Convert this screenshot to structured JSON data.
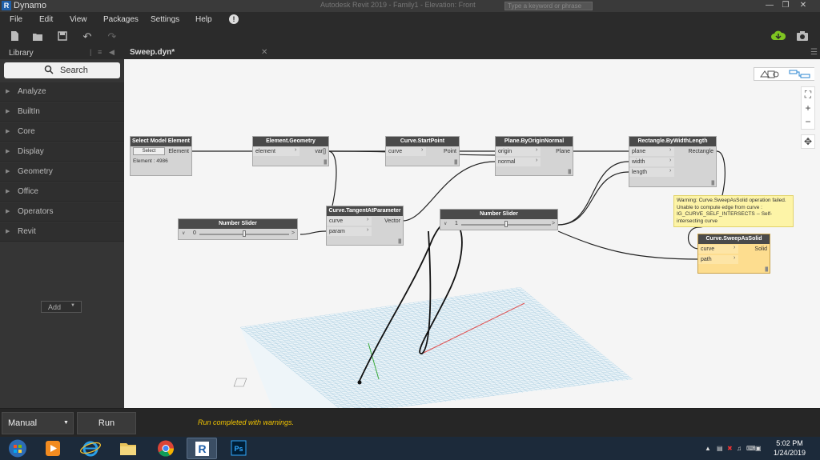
{
  "window": {
    "title": "Dynamo",
    "app_logo_letter": "R",
    "document_title": "Autodesk Revit 2019 - Family1 - Elevation: Front",
    "search_placeholder": "Type a keyword or phrase",
    "controls": [
      "—",
      "❐",
      "✕"
    ]
  },
  "menu": [
    "File",
    "Edit",
    "View",
    "Packages",
    "Settings",
    "Help"
  ],
  "toolbar_icons": [
    "new-file-icon",
    "open-file-icon",
    "save-icon",
    "undo-icon",
    "redo-icon",
    "export-geometry-icon",
    "screenshot-icon"
  ],
  "library": {
    "header": "Library",
    "header_controls": [
      "|",
      "≡",
      "◀"
    ],
    "search_label": "Search",
    "categories": [
      "Analyze",
      "BuiltIn",
      "Core",
      "Display",
      "Geometry",
      "Office",
      "Operators",
      "Revit"
    ],
    "add_label": "Add"
  },
  "tab": {
    "title": "Sweep.dyn*",
    "close": "✕"
  },
  "nodes": {
    "select_model_element": {
      "title": "Select Model Element",
      "button": "Select",
      "output": "Element",
      "info": "Element : 4986"
    },
    "element_geometry": {
      "title": "Element.Geometry",
      "input": "element",
      "output": "var[]"
    },
    "curve_start_point": {
      "title": "Curve.StartPoint",
      "input": "curve",
      "output": "Point"
    },
    "plane_by_origin_normal": {
      "title": "Plane.ByOriginNormal",
      "inputs": [
        "origin",
        "normal"
      ],
      "output": "Plane"
    },
    "rectangle_by_width_length": {
      "title": "Rectangle.ByWidthLength",
      "inputs": [
        "plane",
        "width",
        "length"
      ],
      "output": "Rectangle"
    },
    "curve_tangent_at_parameter": {
      "title": "Curve.TangentAtParameter",
      "inputs": [
        "curve",
        "param"
      ],
      "output": "Vector"
    },
    "number_slider_1": {
      "title": "Number Slider",
      "value": "0",
      "value_fraction": 0.5
    },
    "number_slider_2": {
      "title": "Number Slider",
      "value": "1",
      "value_fraction": 0.5
    },
    "curve_sweep_as_solid": {
      "title": "Curve.SweepAsSolid",
      "inputs": [
        "curve",
        "path"
      ],
      "output": "Solid"
    }
  },
  "warning_text": "Warning: Curve.SweepAsSolid operation failed. Unable to compute edge from curve : IG_CURVE_SELF_INTERSECTS -- Self-intersecting curve",
  "status": {
    "run_mode": "Manual",
    "run_button": "Run",
    "message": "Run completed with warnings."
  },
  "taskbar": {
    "items": [
      "start-button",
      "media-player-icon",
      "internet-explorer-icon",
      "file-explorer-icon",
      "chrome-icon",
      "revit-icon",
      "photoshop-icon"
    ],
    "time": "5:02 PM",
    "date": "1/24/2019"
  },
  "colors": {
    "node_header": "#4a4a4a",
    "warning_node": "#fddd8f",
    "warning_bubble": "#fdf4a7",
    "status_text": "#f2c400",
    "taskbar": "#1c2a3a"
  }
}
